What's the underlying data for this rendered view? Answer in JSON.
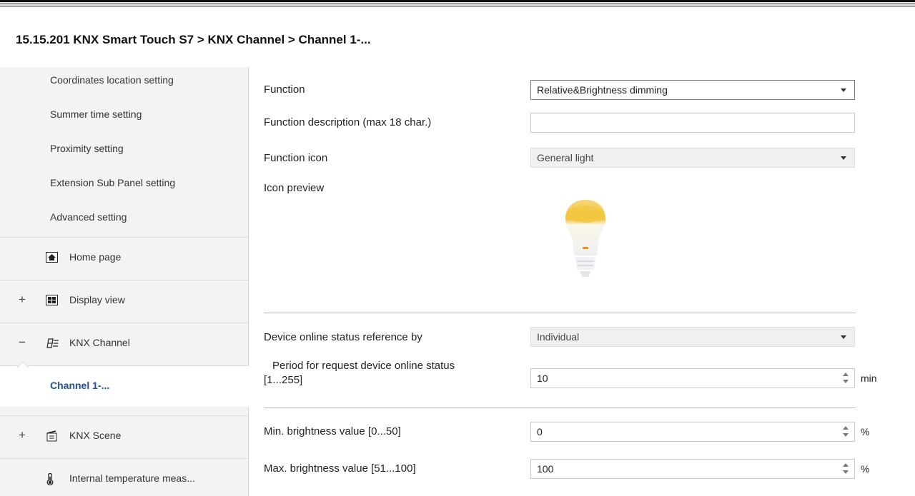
{
  "breadcrumb": "15.15.201 KNX Smart Touch S7 > KNX Channel  > Channel 1-...",
  "sidebar": {
    "sub_items": [
      "Coordinates location setting",
      "Summer time setting",
      "Proximity setting",
      "Extension Sub Panel setting",
      "Advanced setting"
    ],
    "nav_items": [
      {
        "label": "Home page",
        "expander": "",
        "icon": "home-icon"
      },
      {
        "label": "Display view",
        "expander": "+",
        "icon": "display-view-icon"
      },
      {
        "label": "KNX Channel",
        "expander": "−",
        "icon": "knx-channel-icon"
      },
      {
        "label": "Channel 1-...",
        "expander": "",
        "icon": ""
      },
      {
        "label": "KNX Scene",
        "expander": "+",
        "icon": "scene-icon"
      },
      {
        "label": "Internal temperature meas...",
        "expander": "",
        "icon": "thermometer-icon"
      }
    ]
  },
  "form": {
    "function_label": "Function",
    "function_value": "Relative&Brightness dimming",
    "description_label": "Function description (max 18 char.)",
    "description_value": "",
    "icon_label": "Function icon",
    "icon_value": "General light",
    "preview_label": "Icon preview",
    "preview_icon": "light-bulb-icon",
    "online_ref_label": "Device online status reference by",
    "online_ref_value": "Individual",
    "period_label_line1": "Period for request device online status",
    "period_label_line2": "[1...255]",
    "period_value": "10",
    "period_unit": "min",
    "min_brightness_label": "Min. brightness value [0...50]",
    "min_brightness_value": "0",
    "min_brightness_unit": "%",
    "max_brightness_label": "Max. brightness value [51...100]",
    "max_brightness_value": "100",
    "max_brightness_unit": "%"
  },
  "colors": {
    "selected_text": "#1f4e8c",
    "sidebar_bg": "#f3f3f3",
    "bulb_glow": "#f2c53d"
  }
}
